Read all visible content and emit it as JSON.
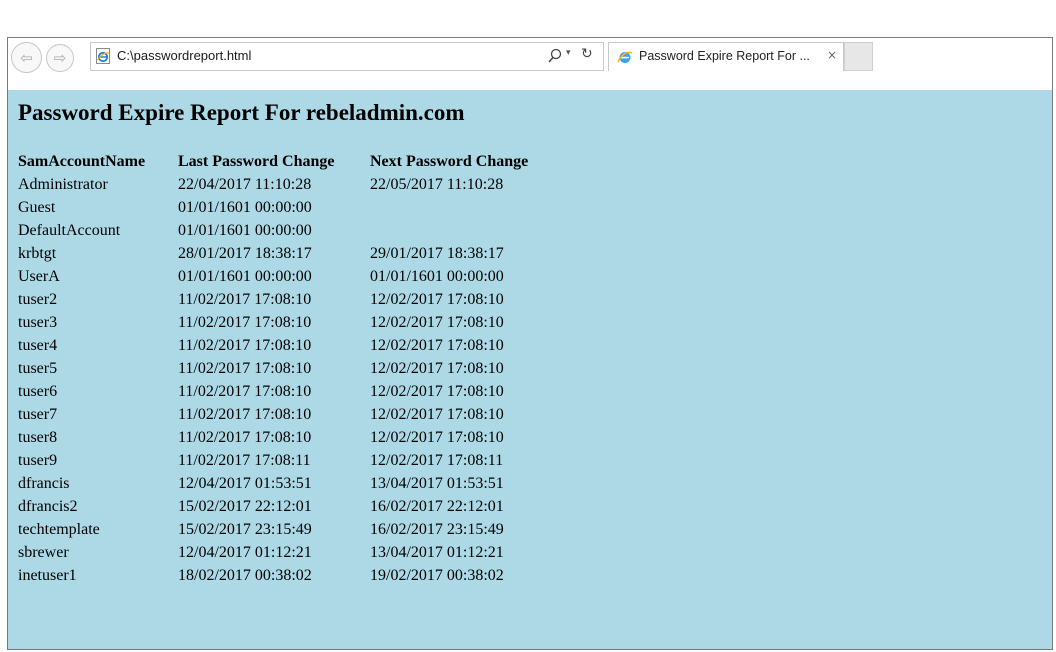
{
  "browser": {
    "address": "C:\\passwordreport.html",
    "tab_title": "Password Expire Report For ...",
    "tab_close": "×",
    "back_label": "⇦",
    "forward_label": "⇨",
    "dropdown_label": "▾",
    "refresh_label": "↻"
  },
  "page": {
    "title": "Password Expire Report For rebeladmin.com",
    "background_color": "#add8e6",
    "table": {
      "headers": [
        "SamAccountName",
        "Last Password Change",
        "Next Password Change"
      ],
      "rows": [
        [
          "Administrator",
          "22/04/2017 11:10:28",
          "22/05/2017 11:10:28"
        ],
        [
          "Guest",
          "01/01/1601 00:00:00",
          ""
        ],
        [
          "DefaultAccount",
          "01/01/1601 00:00:00",
          ""
        ],
        [
          "krbtgt",
          "28/01/2017 18:38:17",
          "29/01/2017 18:38:17"
        ],
        [
          "UserA",
          "01/01/1601 00:00:00",
          "01/01/1601 00:00:00"
        ],
        [
          "tuser2",
          "11/02/2017 17:08:10",
          "12/02/2017 17:08:10"
        ],
        [
          "tuser3",
          "11/02/2017 17:08:10",
          "12/02/2017 17:08:10"
        ],
        [
          "tuser4",
          "11/02/2017 17:08:10",
          "12/02/2017 17:08:10"
        ],
        [
          "tuser5",
          "11/02/2017 17:08:10",
          "12/02/2017 17:08:10"
        ],
        [
          "tuser6",
          "11/02/2017 17:08:10",
          "12/02/2017 17:08:10"
        ],
        [
          "tuser7",
          "11/02/2017 17:08:10",
          "12/02/2017 17:08:10"
        ],
        [
          "tuser8",
          "11/02/2017 17:08:10",
          "12/02/2017 17:08:10"
        ],
        [
          "tuser9",
          "11/02/2017 17:08:11",
          "12/02/2017 17:08:11"
        ],
        [
          "dfrancis",
          "12/04/2017 01:53:51",
          "13/04/2017 01:53:51"
        ],
        [
          "dfrancis2",
          "15/02/2017 22:12:01",
          "16/02/2017 22:12:01"
        ],
        [
          "techtemplate",
          "15/02/2017 23:15:49",
          "16/02/2017 23:15:49"
        ],
        [
          "sbrewer",
          "12/04/2017 01:12:21",
          "13/04/2017 01:12:21"
        ],
        [
          "inetuser1",
          "18/02/2017 00:38:02",
          "19/02/2017 00:38:02"
        ]
      ]
    }
  },
  "icons": {
    "back": "back-arrow-icon",
    "forward": "forward-arrow-icon",
    "page": "ie-page-icon",
    "search": "search-icon",
    "refresh": "refresh-icon",
    "tab": "ie-logo-icon",
    "close": "close-icon"
  }
}
